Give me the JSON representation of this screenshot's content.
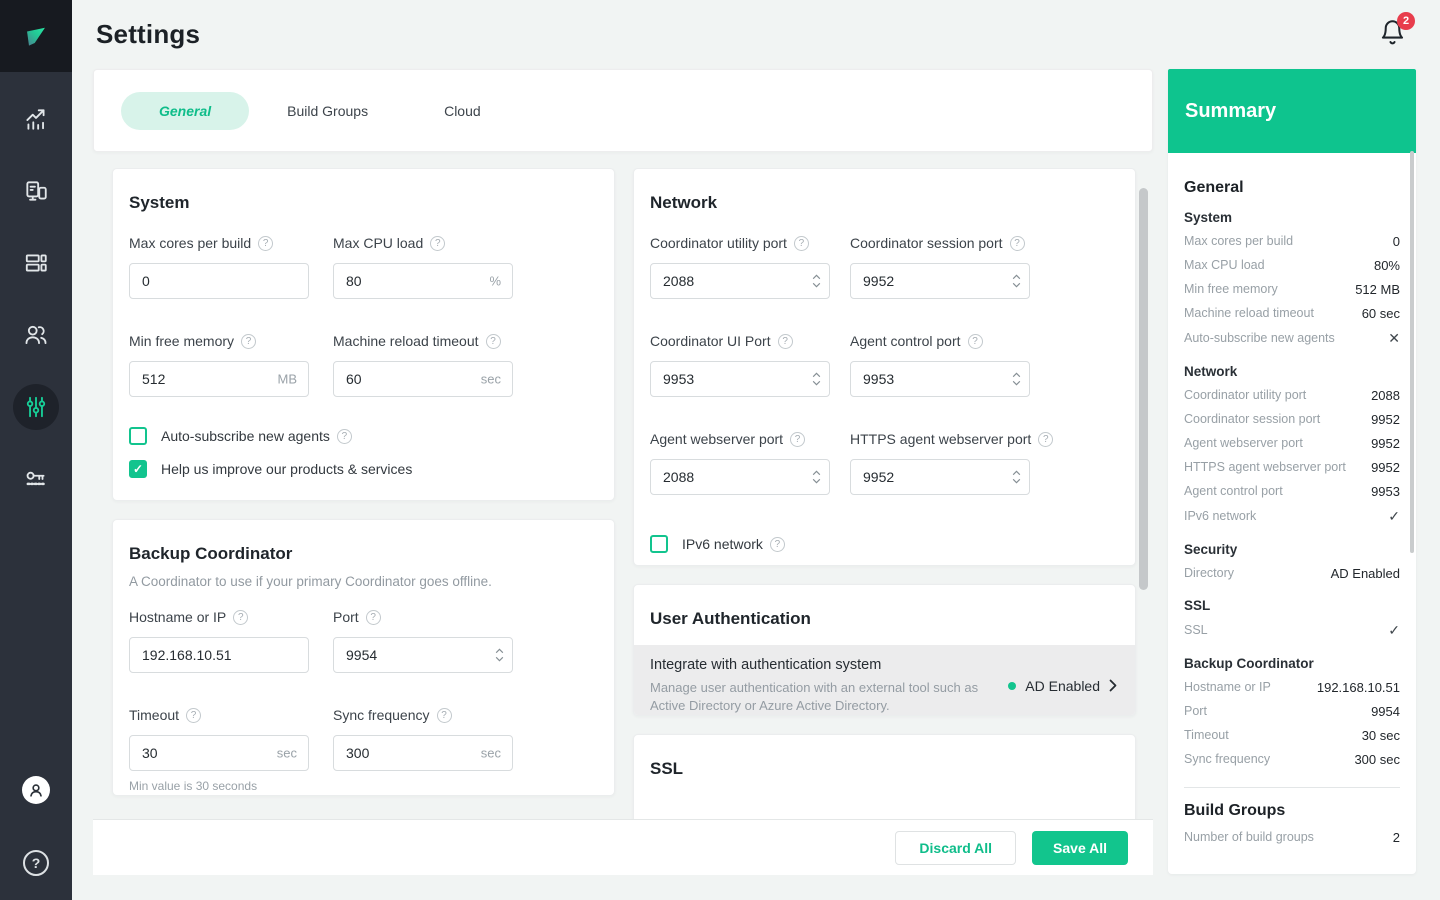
{
  "colors": {
    "accent": "#0ec48e",
    "accent_light": "#d8f3ea",
    "badge_red": "#e83d4c",
    "sidebar_bg": "#2c313b"
  },
  "header": {
    "title": "Settings",
    "notification_count": "2"
  },
  "sidebar": {
    "items": [
      {
        "name": "dashboard",
        "icon": "chart-icon"
      },
      {
        "name": "agents",
        "icon": "agents-icon"
      },
      {
        "name": "builds",
        "icon": "grid-icon"
      },
      {
        "name": "users",
        "icon": "users-icon"
      },
      {
        "name": "settings",
        "icon": "sliders-icon",
        "active": true
      },
      {
        "name": "licenses",
        "icon": "key-icon"
      }
    ],
    "bottom": [
      {
        "name": "account",
        "icon": "avatar-icon"
      },
      {
        "name": "help",
        "icon": "question-icon"
      }
    ]
  },
  "tabs": [
    {
      "label": "General",
      "active": true
    },
    {
      "label": "Build Groups",
      "active": false
    },
    {
      "label": "Cloud",
      "active": false
    }
  ],
  "system": {
    "title": "System",
    "fields": [
      {
        "label": "Max cores per build",
        "value": "0",
        "suffix": ""
      },
      {
        "label": "Max CPU load",
        "value": "80",
        "suffix": "%"
      },
      {
        "label": "Min free memory",
        "value": "512",
        "suffix": "MB"
      },
      {
        "label": "Machine reload timeout",
        "value": "60",
        "suffix": "sec"
      }
    ],
    "checkboxes": [
      {
        "label": "Auto-subscribe new agents",
        "checked": false
      },
      {
        "label": "Help us improve our products & services",
        "checked": true
      }
    ]
  },
  "backup": {
    "title": "Backup Coordinator",
    "subtitle": "A Coordinator to use if your primary Coordinator goes offline.",
    "fields": [
      {
        "label": "Hostname or IP",
        "value": "192.168.10.51"
      },
      {
        "label": "Port",
        "value": "9954"
      },
      {
        "label": "Timeout",
        "value": "30",
        "suffix": "sec"
      },
      {
        "label": "Sync frequency",
        "value": "300",
        "suffix": "sec"
      }
    ],
    "hint": "Min value is 30 seconds"
  },
  "network": {
    "title": "Network",
    "fields": [
      {
        "label": "Coordinator utility port",
        "value": "2088"
      },
      {
        "label": "Coordinator session port",
        "value": "9952"
      },
      {
        "label": "Coordinator UI Port",
        "value": "9953"
      },
      {
        "label": "Agent control port",
        "value": "9953"
      },
      {
        "label": "Agent webserver port",
        "value": "2088"
      },
      {
        "label": "HTTPS agent webserver port",
        "value": "9952"
      }
    ],
    "checkbox": {
      "label": "IPv6 network",
      "checked": false
    }
  },
  "auth": {
    "title": "User Authentication",
    "row_title": "Integrate with authentication system",
    "row_desc": "Manage user authentication with an external tool such as Active Directory or Azure Active Directory.",
    "status": "AD Enabled"
  },
  "ssl": {
    "title": "SSL"
  },
  "footer": {
    "discard_label": "Discard All",
    "save_label": "Save All"
  },
  "summary": {
    "title": "Summary",
    "groups": [
      {
        "title": "General",
        "level": 1,
        "rows": []
      },
      {
        "title": "System",
        "level": 2,
        "rows": [
          {
            "label": "Max cores per build",
            "value": "0"
          },
          {
            "label": "Max CPU load",
            "value": "80%"
          },
          {
            "label": "Min free memory",
            "value": "512 MB"
          },
          {
            "label": "Machine reload timeout",
            "value": "60 sec"
          },
          {
            "label": "Auto-subscribe new agents",
            "value": "✕",
            "glyph": true
          }
        ]
      },
      {
        "title": "Network",
        "level": 2,
        "rows": [
          {
            "label": "Coordinator utility port",
            "value": "2088"
          },
          {
            "label": "Coordinator session port",
            "value": "9952"
          },
          {
            "label": "Agent webserver port",
            "value": "9952"
          },
          {
            "label": "HTTPS agent webserver port",
            "value": "9952"
          },
          {
            "label": "Agent control port",
            "value": "9953"
          },
          {
            "label": "IPv6 network",
            "value": "✓",
            "glyph": true
          }
        ]
      },
      {
        "title": "Security",
        "level": 2,
        "rows": [
          {
            "label": "Directory",
            "value": "AD Enabled"
          }
        ]
      },
      {
        "title": "SSL",
        "level": 2,
        "rows": [
          {
            "label": "SSL",
            "value": "✓",
            "glyph": true
          }
        ]
      },
      {
        "title": "Backup Coordinator",
        "level": 2,
        "rows": [
          {
            "label": "Hostname or IP",
            "value": "192.168.10.51"
          },
          {
            "label": "Port",
            "value": "9954"
          },
          {
            "label": "Timeout",
            "value": "30 sec"
          },
          {
            "label": "Sync frequency",
            "value": "300 sec"
          }
        ]
      },
      {
        "title": "Build Groups",
        "level": 1,
        "divider": true,
        "rows": [
          {
            "label": "Number of build groups",
            "value": "2"
          }
        ]
      }
    ]
  }
}
